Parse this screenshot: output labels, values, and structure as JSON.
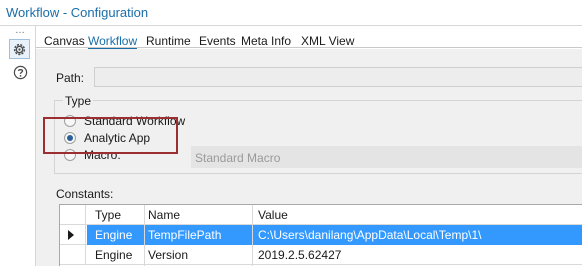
{
  "window": {
    "title": "Workflow - Configuration"
  },
  "rail": {
    "dots": "…"
  },
  "tabs": [
    {
      "label": "Canvas"
    },
    {
      "label": "Workflow"
    },
    {
      "label": "Runtime"
    },
    {
      "label": "Events"
    },
    {
      "label": "Meta Info"
    },
    {
      "label": "XML View"
    }
  ],
  "active_tab": "Workflow",
  "path": {
    "label": "Path:",
    "value": ""
  },
  "type": {
    "label": "Type",
    "options": [
      {
        "label": "Standard Workflow",
        "selected": false
      },
      {
        "label": "Analytic App",
        "selected": true
      },
      {
        "label": "Macro:",
        "selected": false
      }
    ],
    "macro_select": "Standard Macro"
  },
  "constants": {
    "label": "Constants:",
    "columns": [
      "Type",
      "Name",
      "Value"
    ],
    "rows": [
      {
        "type": "Engine",
        "name": "TempFilePath",
        "value": "C:\\Users\\danilang\\AppData\\Local\\Temp\\1\\"
      },
      {
        "type": "Engine",
        "name": "Version",
        "value": "2019.2.5.62427"
      }
    ]
  },
  "colors": {
    "accent": "#1a6ea8",
    "selection": "#3399ff",
    "highlight_box": "#9b2f2f"
  }
}
